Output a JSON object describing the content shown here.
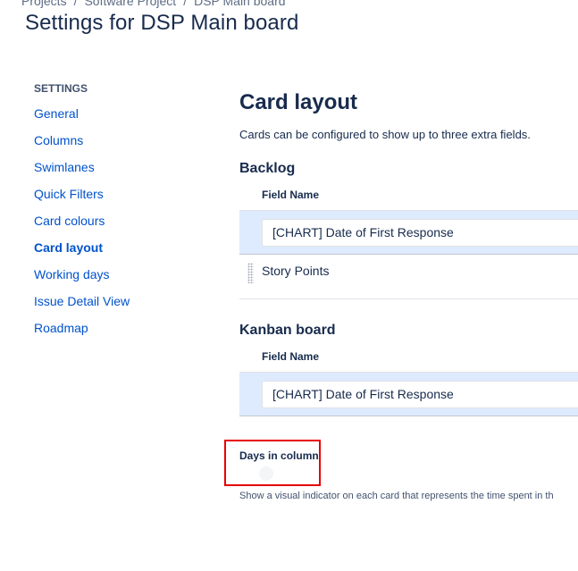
{
  "breadcrumb": {
    "items": [
      "Projects",
      "Software Project",
      "DSP Main board"
    ],
    "separator": "/"
  },
  "page": {
    "title": "Settings for DSP Main board"
  },
  "sidebar": {
    "heading": "SETTINGS",
    "items": [
      {
        "label": "General",
        "active": false
      },
      {
        "label": "Columns",
        "active": false
      },
      {
        "label": "Swimlanes",
        "active": false
      },
      {
        "label": "Quick Filters",
        "active": false
      },
      {
        "label": "Card colours",
        "active": false
      },
      {
        "label": "Card layout",
        "active": true
      },
      {
        "label": "Working days",
        "active": false
      },
      {
        "label": "Issue Detail View",
        "active": false
      },
      {
        "label": "Roadmap",
        "active": false
      }
    ]
  },
  "main": {
    "title": "Card layout",
    "description": "Cards can be configured to show up to three extra fields.",
    "backlog": {
      "title": "Backlog",
      "column_header": "Field Name",
      "add_field_value": "[CHART] Date of First Response",
      "fields": [
        "Story Points"
      ]
    },
    "kanban": {
      "title": "Kanban board",
      "column_header": "Field Name",
      "add_field_value": "[CHART] Date of First Response"
    },
    "days_in_column": {
      "label": "Days in column",
      "enabled": false,
      "description": "Show a visual indicator on each card that represents the time spent in th"
    }
  },
  "colors": {
    "link": "#0052cc",
    "text": "#172b4d",
    "row_highlight": "#deebff",
    "annotation_box": "#e60000"
  }
}
